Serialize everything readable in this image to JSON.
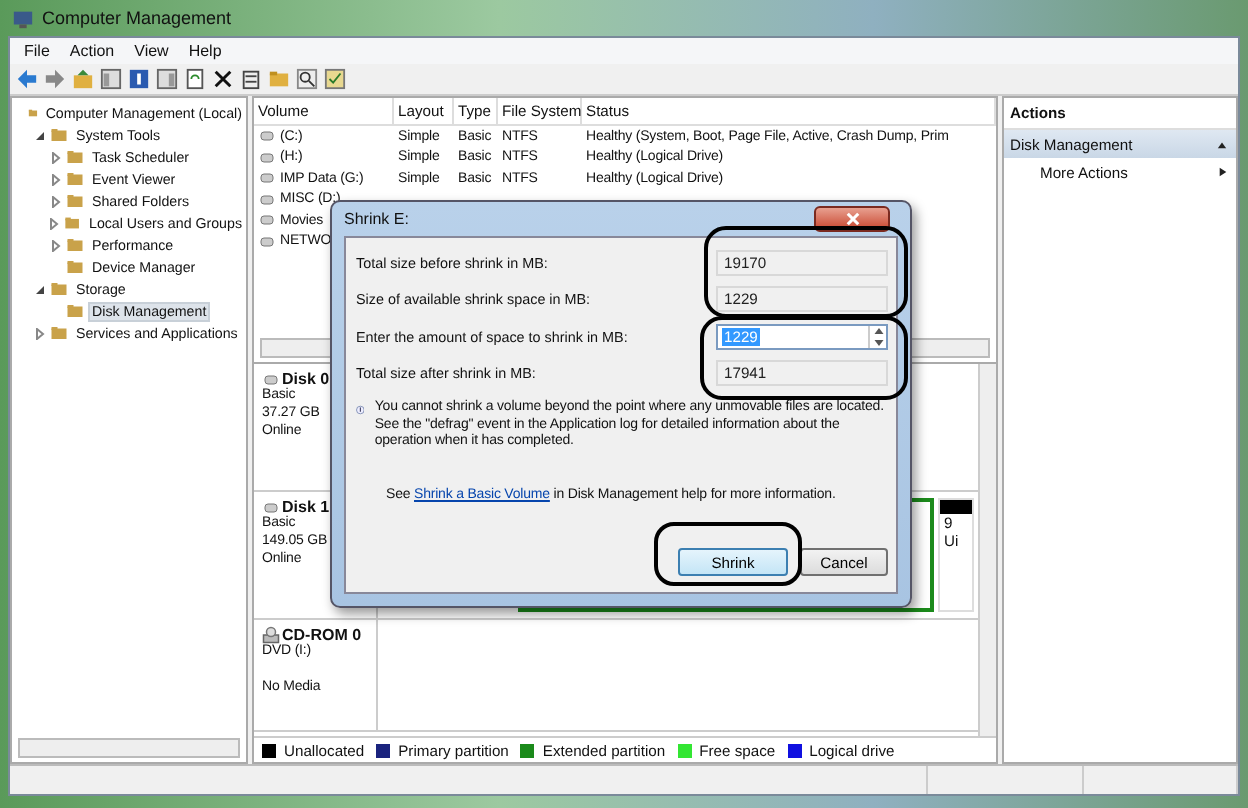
{
  "window": {
    "title": "Computer Management"
  },
  "menu": [
    {
      "label": "File"
    },
    {
      "label": "Action"
    },
    {
      "label": "View"
    },
    {
      "label": "Help"
    }
  ],
  "tree": [
    {
      "label": "Computer Management (Local)",
      "selected": false,
      "children": [
        {
          "label": "System Tools",
          "expanded": true,
          "selected": false,
          "children": [
            {
              "label": "Task Scheduler",
              "expanded": false,
              "selected": false
            },
            {
              "label": "Event Viewer",
              "expanded": false,
              "selected": false
            },
            {
              "label": "Shared Folders",
              "expanded": false,
              "selected": false
            },
            {
              "label": "Local Users and Groups",
              "expanded": false,
              "selected": false
            },
            {
              "label": "Performance",
              "expanded": false,
              "selected": false
            },
            {
              "label": "Device Manager",
              "selected": false
            }
          ]
        },
        {
          "label": "Storage",
          "expanded": true,
          "selected": false,
          "children": [
            {
              "label": "Disk Management",
              "selected": true
            }
          ]
        },
        {
          "label": "Services and Applications",
          "expanded": false,
          "selected": false
        }
      ]
    }
  ],
  "volumes": {
    "columns": [
      "Volume",
      "Layout",
      "Type",
      "File System",
      "Status"
    ],
    "rows": [
      {
        "cells": [
          "(C:)",
          "Simple",
          "Basic",
          "NTFS",
          "Healthy (System, Boot, Page File, Active, Crash Dump, Prim"
        ]
      },
      {
        "cells": [
          "(H:)",
          "Simple",
          "Basic",
          "NTFS",
          "Healthy (Logical Drive)"
        ]
      },
      {
        "cells": [
          "IMP Data (G:)",
          "Simple",
          "Basic",
          "NTFS",
          "Healthy (Logical Drive)"
        ]
      },
      {
        "cells": [
          "MISC (D:)"
        ]
      },
      {
        "cells": [
          "Movies"
        ]
      },
      {
        "cells": [
          "NETWO"
        ]
      }
    ]
  },
  "disks": [
    {
      "kind": "disk",
      "name": "Disk 0",
      "lines": [
        "Basic",
        "37.27 GB",
        "Online"
      ]
    },
    {
      "kind": "disk",
      "name": "Disk 1",
      "lines": [
        "Basic",
        "149.05 GB",
        "Online"
      ],
      "partitions": [
        {
          "kind": "extended"
        },
        {
          "kind": "unallocated",
          "lines": [
            "9",
            "Ui"
          ]
        }
      ]
    },
    {
      "kind": "cdrom",
      "name": "CD-ROM 0",
      "lines": [
        "DVD (I:)",
        "No Media"
      ]
    }
  ],
  "legend": [
    {
      "label": "Unallocated",
      "color": "#000000"
    },
    {
      "label": "Primary partition",
      "color": "#1a237e"
    },
    {
      "label": "Extended partition",
      "color": "#1b8a1b"
    },
    {
      "label": "Free space",
      "color": "#33e633"
    },
    {
      "label": "Logical drive",
      "color": "#1010e0"
    }
  ],
  "actions": {
    "title": "Actions",
    "items": [
      {
        "kind": "section",
        "label": "Disk Management",
        "selected": true
      },
      {
        "kind": "item",
        "label": "More Actions",
        "selected": false
      }
    ]
  },
  "dialog": {
    "title": "Shrink E:",
    "fields": [
      {
        "kind": "readonly",
        "label": "Total size before shrink in MB:",
        "value": "19170"
      },
      {
        "kind": "readonly",
        "label": "Size of available shrink space in MB:",
        "value": "1229"
      },
      {
        "kind": "spin",
        "label": "Enter the amount of space to shrink in MB:",
        "value": "1229"
      },
      {
        "kind": "readonly",
        "label": "Total size after shrink in MB:",
        "value": "17941"
      }
    ],
    "message": "You cannot shrink a volume beyond the point where any unmovable files are located. See the \"defrag\" event in the Application log for detailed information about the operation when it has completed.",
    "help": {
      "before": "See ",
      "link": "Shrink a Basic Volume",
      "after": " in Disk Management help for more information."
    },
    "buttons": [
      {
        "label": "Shrink",
        "default": true
      },
      {
        "label": "Cancel",
        "default": false
      }
    ]
  }
}
